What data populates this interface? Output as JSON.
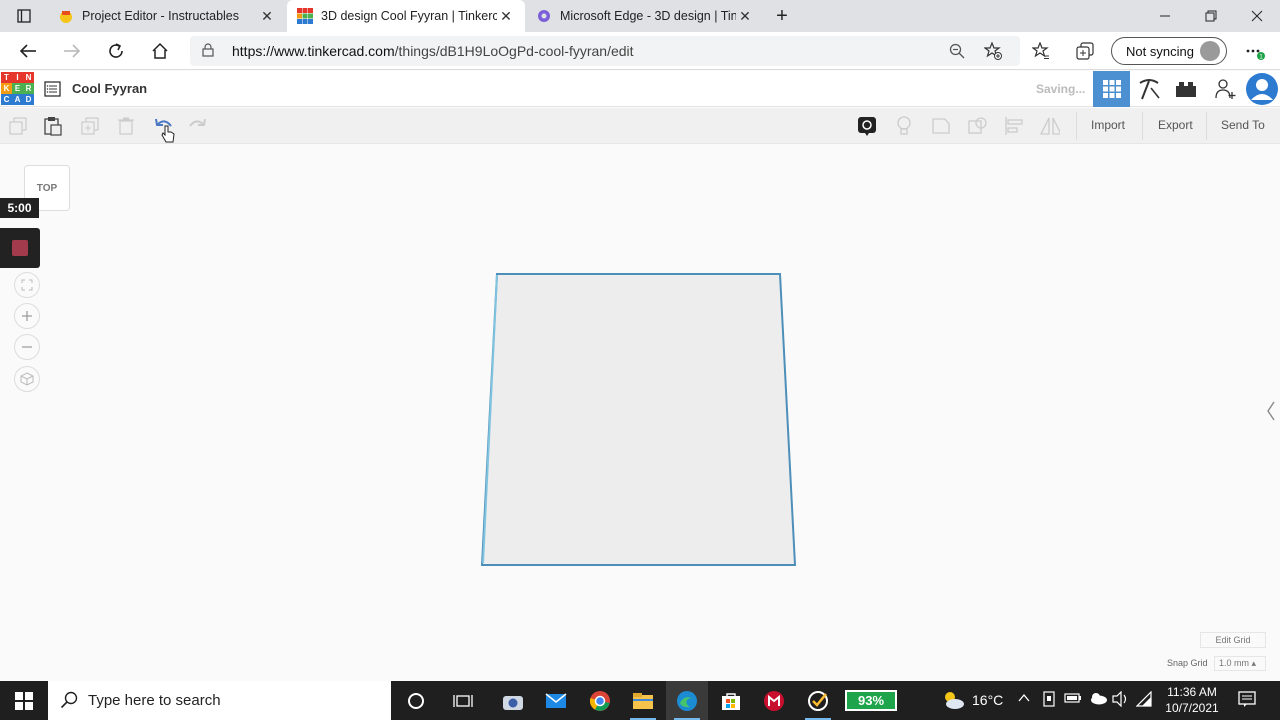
{
  "browser": {
    "tabs": [
      {
        "title": "Project Editor - Instructables",
        "close": "✕"
      },
      {
        "title": "3D design Cool Fyyran | Tinkercad",
        "close": "✕"
      },
      {
        "title": "Microsoft Edge - 3D design | Tinkercad",
        "close": "✕"
      }
    ],
    "new_tab": "+",
    "url_host": "https://www.tinkercad.com",
    "url_path": "/things/dB1H9LoOgPd-cool-fyyran/edit",
    "sync_label": "Not syncing"
  },
  "app": {
    "logo_letters": [
      "T",
      "I",
      "N",
      "K",
      "E",
      "R",
      "C",
      "A",
      "D"
    ],
    "logo_colors": [
      "#e6362b",
      "#e6362b",
      "#e6362b",
      "#f39c12",
      "#4caf50",
      "#4caf50",
      "#2c7bd1",
      "#2c7bd1",
      "#2c7bd1"
    ],
    "design_name": "Cool Fyyran",
    "status": "Saving...",
    "accent": "#4d90d1"
  },
  "toolbar": {
    "import_label": "Import",
    "export_label": "Export",
    "send_to_label": "Send To"
  },
  "canvas": {
    "viewcube_label": "TOP",
    "timer": "5:00",
    "edit_grid_label": "Edit Grid",
    "snap_grid_label": "Snap Grid",
    "snap_grid_value": "1.0 mm ▴"
  },
  "taskbar": {
    "search_placeholder": "Type here to search",
    "battery": "93%",
    "temperature": "16°C",
    "time": "11:36 AM",
    "date": "10/7/2021"
  }
}
